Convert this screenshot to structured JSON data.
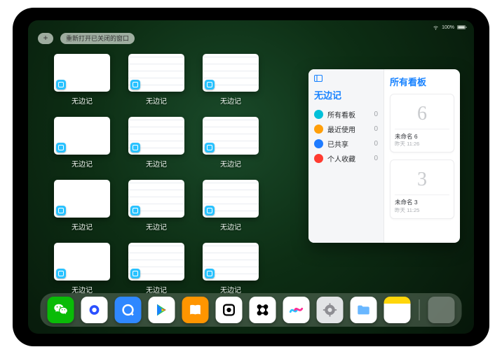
{
  "status": {
    "wifi": "􀙇",
    "battery_pct": "100%"
  },
  "topbar": {
    "plus": "+",
    "reopen_label": "重新打开已关闭的窗口"
  },
  "switcher": {
    "app_label": "无边记",
    "windows": [
      {
        "variant": "blank"
      },
      {
        "variant": "busy"
      },
      {
        "variant": "busy"
      },
      {
        "variant": "blank"
      },
      {
        "variant": "busy"
      },
      {
        "variant": "busy"
      },
      {
        "variant": "blank"
      },
      {
        "variant": "busy"
      },
      {
        "variant": "busy"
      },
      {
        "variant": "blank"
      },
      {
        "variant": "busy"
      },
      {
        "variant": "busy"
      }
    ]
  },
  "panel": {
    "left_title": "无边记",
    "sidebar": [
      {
        "icon": "grid",
        "color": "cyan",
        "label": "所有看板",
        "count": 0
      },
      {
        "icon": "clock",
        "color": "orange",
        "label": "最近使用",
        "count": 0
      },
      {
        "icon": "people",
        "color": "blue",
        "label": "已共享",
        "count": 0
      },
      {
        "icon": "heart",
        "color": "red",
        "label": "个人收藏",
        "count": 0
      }
    ],
    "right_title": "所有看板",
    "boards": [
      {
        "scribble": "6",
        "title": "未命名 6",
        "subtitle": "昨天 11:26"
      },
      {
        "scribble": "3",
        "title": "未命名 3",
        "subtitle": "昨天 11:25"
      }
    ]
  },
  "dock": {
    "apps": [
      {
        "name": "wechat-icon"
      },
      {
        "name": "browser-icon"
      },
      {
        "name": "qqbrowser-icon"
      },
      {
        "name": "play-store-icon"
      },
      {
        "name": "books-icon"
      },
      {
        "name": "box-dot-icon"
      },
      {
        "name": "link-dots-icon"
      },
      {
        "name": "freeform-icon"
      },
      {
        "name": "settings-icon"
      },
      {
        "name": "files-icon"
      },
      {
        "name": "notes-icon"
      }
    ]
  }
}
